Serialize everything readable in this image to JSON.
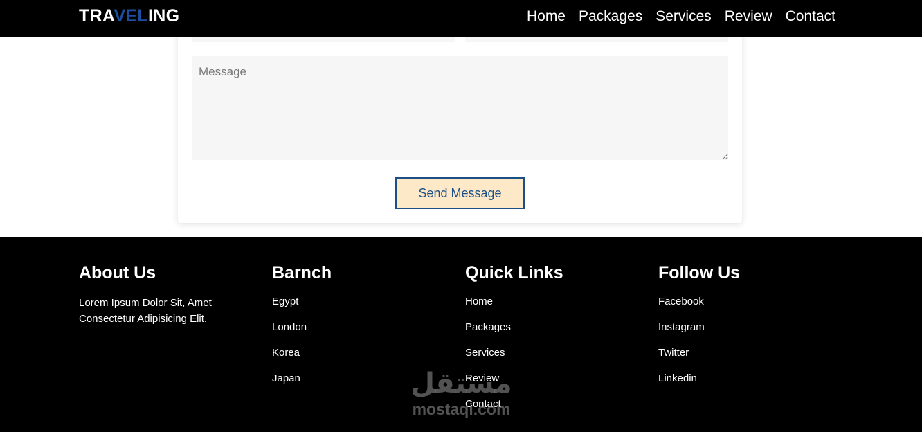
{
  "header": {
    "logo_part1": "TRA",
    "logo_part2": "VEL",
    "logo_part3": "ING",
    "nav": [
      {
        "label": "Home"
      },
      {
        "label": "Packages"
      },
      {
        "label": "Services"
      },
      {
        "label": "Review"
      },
      {
        "label": "Contact"
      }
    ]
  },
  "contact_form": {
    "message_placeholder": "Message",
    "send_label": "Send Message"
  },
  "footer": {
    "about": {
      "title": "About Us",
      "text": "Lorem Ipsum Dolor Sit, Amet Consectetur Adipisicing Elit."
    },
    "branch": {
      "title": "Barnch",
      "items": [
        "Egypt",
        "London",
        "Korea",
        "Japan"
      ]
    },
    "quick_links": {
      "title": "Quick Links",
      "items": [
        "Home",
        "Packages",
        "Services",
        "Review",
        "Contact"
      ]
    },
    "follow": {
      "title": "Follow Us",
      "items": [
        "Facebook",
        "Instagram",
        "Twitter",
        "Linkedin"
      ]
    }
  },
  "watermark": {
    "arabic": "مستقل",
    "latin": "mostaqi.com"
  },
  "colors": {
    "header_bg": "#000000",
    "logo_accent": "#1c4fa0",
    "button_bg": "#fde9c7",
    "button_border": "#1c4f86",
    "field_bg": "#f6f6f6"
  }
}
